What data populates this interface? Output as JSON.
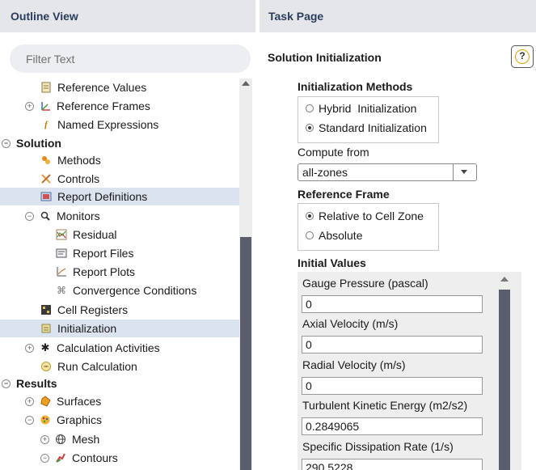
{
  "outline": {
    "title": "Outline View",
    "filter_placeholder": "Filter Text",
    "items": [
      {
        "label": "Reference Values",
        "icon": "reference-values-icon"
      },
      {
        "label": "Reference Frames",
        "icon": "reference-frames-icon"
      },
      {
        "label": "Named Expressions",
        "icon": "named-expressions-icon"
      },
      {
        "label": "Solution"
      },
      {
        "label": "Methods",
        "icon": "methods-icon"
      },
      {
        "label": "Controls",
        "icon": "controls-icon"
      },
      {
        "label": "Report Definitions",
        "icon": "report-definitions-icon"
      },
      {
        "label": "Monitors",
        "icon": "monitors-icon"
      },
      {
        "label": "Residual",
        "icon": "residual-icon"
      },
      {
        "label": "Report Files",
        "icon": "report-files-icon"
      },
      {
        "label": "Report Plots",
        "icon": "report-plots-icon"
      },
      {
        "label": "Convergence Conditions",
        "icon": "convergence-icon"
      },
      {
        "label": "Cell Registers",
        "icon": "cell-registers-icon"
      },
      {
        "label": "Initialization",
        "icon": "initialization-icon"
      },
      {
        "label": "Calculation Activities",
        "icon": "calculation-activities-icon"
      },
      {
        "label": "Run Calculation",
        "icon": "run-calculation-icon"
      },
      {
        "label": "Results"
      },
      {
        "label": "Surfaces",
        "icon": "surfaces-icon"
      },
      {
        "label": "Graphics",
        "icon": "graphics-icon"
      },
      {
        "label": "Mesh",
        "icon": "mesh-icon"
      },
      {
        "label": "Contours",
        "icon": "contours-icon"
      }
    ]
  },
  "task": {
    "title": "Task Page",
    "page_title": "Solution Initialization",
    "help_glyph": "?",
    "methods": {
      "heading": "Initialization Methods",
      "options": [
        "Hybrid  Initialization",
        "Standard Initialization"
      ],
      "selected": "Standard Initialization"
    },
    "compute_from": {
      "label": "Compute from",
      "value": "all-zones"
    },
    "reference_frame": {
      "heading": "Reference Frame",
      "options": [
        "Relative to Cell Zone",
        "Absolute"
      ],
      "selected": "Relative to Cell Zone"
    },
    "initial_values": {
      "heading": "Initial Values",
      "fields": [
        {
          "label": "Gauge Pressure (pascal)",
          "value": "0"
        },
        {
          "label": "Axial Velocity (m/s)",
          "value": "0"
        },
        {
          "label": "Radial Velocity (m/s)",
          "value": "0"
        },
        {
          "label": "Turbulent Kinetic Energy (m2/s2)",
          "value": "0.2849065"
        },
        {
          "label": "Specific Dissipation Rate (1/s)",
          "value": "290.5228"
        }
      ]
    }
  },
  "colors": {
    "header_bg": "#e4e6ea",
    "header_text": "#2a3d5a",
    "selection": "#dbe3ef",
    "scroll_thumb": "#5a5d6b"
  }
}
